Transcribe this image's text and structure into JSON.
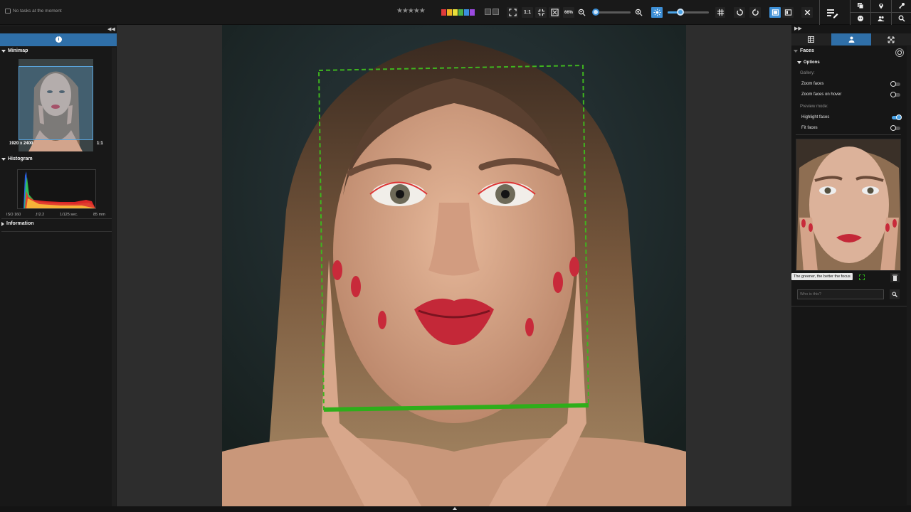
{
  "status": {
    "tasks_text": "No tasks at the moment"
  },
  "toolbar": {
    "rating_stars": "★★★★★",
    "color_labels": [
      "#e03a3a",
      "#f0b323",
      "#e8e03a",
      "#4ab04a",
      "#3a8fe0",
      "#9b4ae0"
    ],
    "one_to_one": "1:1",
    "zoom_level": "66%",
    "zoom_fraction": 0.0,
    "focus_peaking_fraction": 0.3,
    "accent": "#3d8fd6"
  },
  "left": {
    "minimap": {
      "title": "Minimap",
      "dimensions": "1920 x 2400",
      "ratio": "1:1"
    },
    "histogram": {
      "title": "Histogram",
      "iso": "ISO 160",
      "aperture": "ƒ/2.2",
      "shutter": "1/125 sec.",
      "focal": "85 mm"
    },
    "information": {
      "title": "Information"
    }
  },
  "right": {
    "faces_title": "Faces",
    "options_title": "Options",
    "gallery_label": "Gallery:",
    "zoom_faces": "Zoom faces",
    "zoom_faces_on_hover": "Zoom faces on hover",
    "preview_mode_label": "Preview mode:",
    "highlight_faces": "Highlight faces",
    "fit_faces": "Fit faces",
    "toggles": {
      "zoom_faces": false,
      "zoom_faces_on_hover": false,
      "highlight_faces": true,
      "fit_faces": false
    },
    "tooltip": "The greener, the better the focus",
    "who_placeholder": "Who is this?",
    "focus_color": "#2eae1a"
  }
}
